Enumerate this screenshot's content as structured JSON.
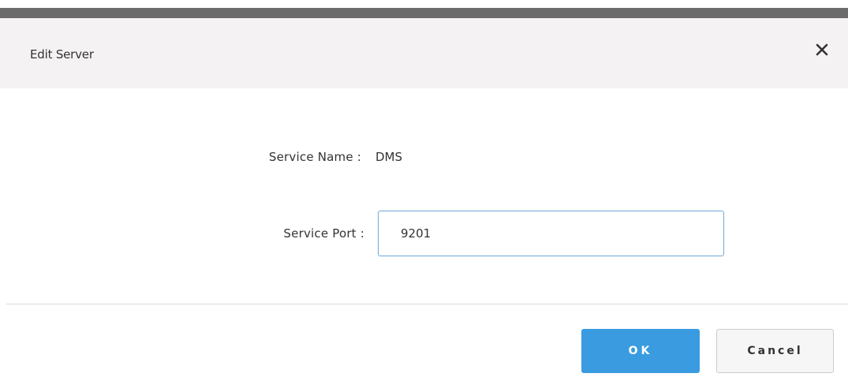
{
  "dialog": {
    "title": "Edit Server",
    "close_icon": "close-icon"
  },
  "form": {
    "service_name": {
      "label": "Service Name :",
      "value": "DMS"
    },
    "service_port": {
      "label": "Service Port :",
      "value": "9201"
    }
  },
  "footer": {
    "ok_label": "OK",
    "cancel_label": "Cancel"
  },
  "colors": {
    "accent": "#3a9be0",
    "header_bg": "#f4f2f3",
    "top_strip": "#6b6b6b",
    "input_border": "#6fa8dc"
  }
}
